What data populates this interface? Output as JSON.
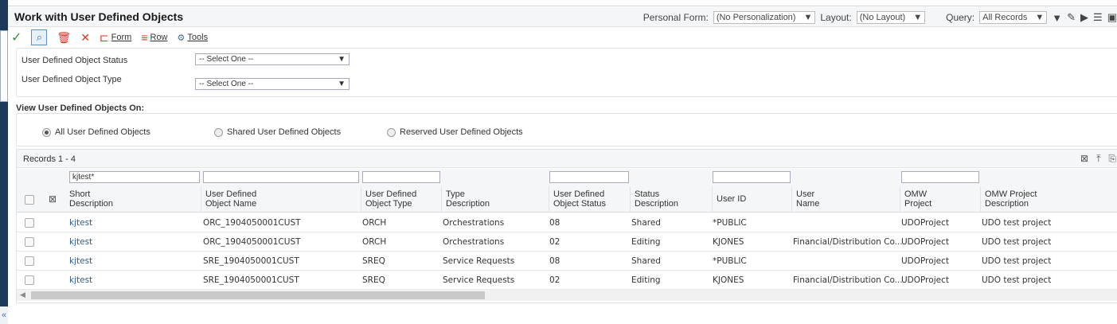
{
  "header": {
    "title": "Work with User Defined Objects",
    "personal_form_label": "Personal Form:",
    "personal_form_value": "(No Personalization)",
    "layout_label": "Layout:",
    "layout_value": "(No Layout)",
    "query_label": "Query:",
    "query_value": "All Records"
  },
  "toolbar": {
    "form_label": "Form",
    "row_label": "Row",
    "tools_label": "Tools"
  },
  "filters": {
    "status_label": "User Defined Object Status",
    "status_value": "-- Select One --",
    "type_label": "User Defined Object Type",
    "type_value": "-- Select One --"
  },
  "view_on": {
    "label": "View User Defined Objects On:",
    "options": [
      "All User Defined Objects",
      "Shared User Defined Objects",
      "Reserved User Defined Objects"
    ],
    "selected": 0
  },
  "grid": {
    "records_label": "Records 1 - 4",
    "qbe_short_description": "kjtest*",
    "columns": [
      [
        "Short",
        "Description"
      ],
      [
        "User Defined",
        "Object Name"
      ],
      [
        "User Defined",
        "Object Type"
      ],
      [
        "Type",
        "Description"
      ],
      [
        "User Defined",
        "Object Status"
      ],
      [
        "Status",
        "Description"
      ],
      [
        "User ID",
        ""
      ],
      [
        "User",
        "Name"
      ],
      [
        "OMW",
        "Project"
      ],
      [
        "OMW Project",
        "Description"
      ]
    ],
    "rows": [
      [
        "kjtest",
        "ORC_1904050001CUST",
        "ORCH",
        "Orchestrations",
        "08",
        "Shared",
        "*PUBLIC",
        "",
        "UDOProject",
        "UDO test project"
      ],
      [
        "kjtest",
        "ORC_1904050001CUST",
        "ORCH",
        "Orchestrations",
        "02",
        "Editing",
        "KJONES",
        "Financial/Distribution Co...",
        "UDOProject",
        "UDO test project"
      ],
      [
        "kjtest",
        "SRE_1904050001CUST",
        "SREQ",
        "Service Requests",
        "08",
        "Shared",
        "*PUBLIC",
        "",
        "UDOProject",
        "UDO test project"
      ],
      [
        "kjtest",
        "SRE_1904050001CUST",
        "SREQ",
        "Service Requests",
        "02",
        "Editing",
        "KJONES",
        "Financial/Distribution Co...",
        "UDOProject",
        "UDO test project"
      ]
    ]
  }
}
